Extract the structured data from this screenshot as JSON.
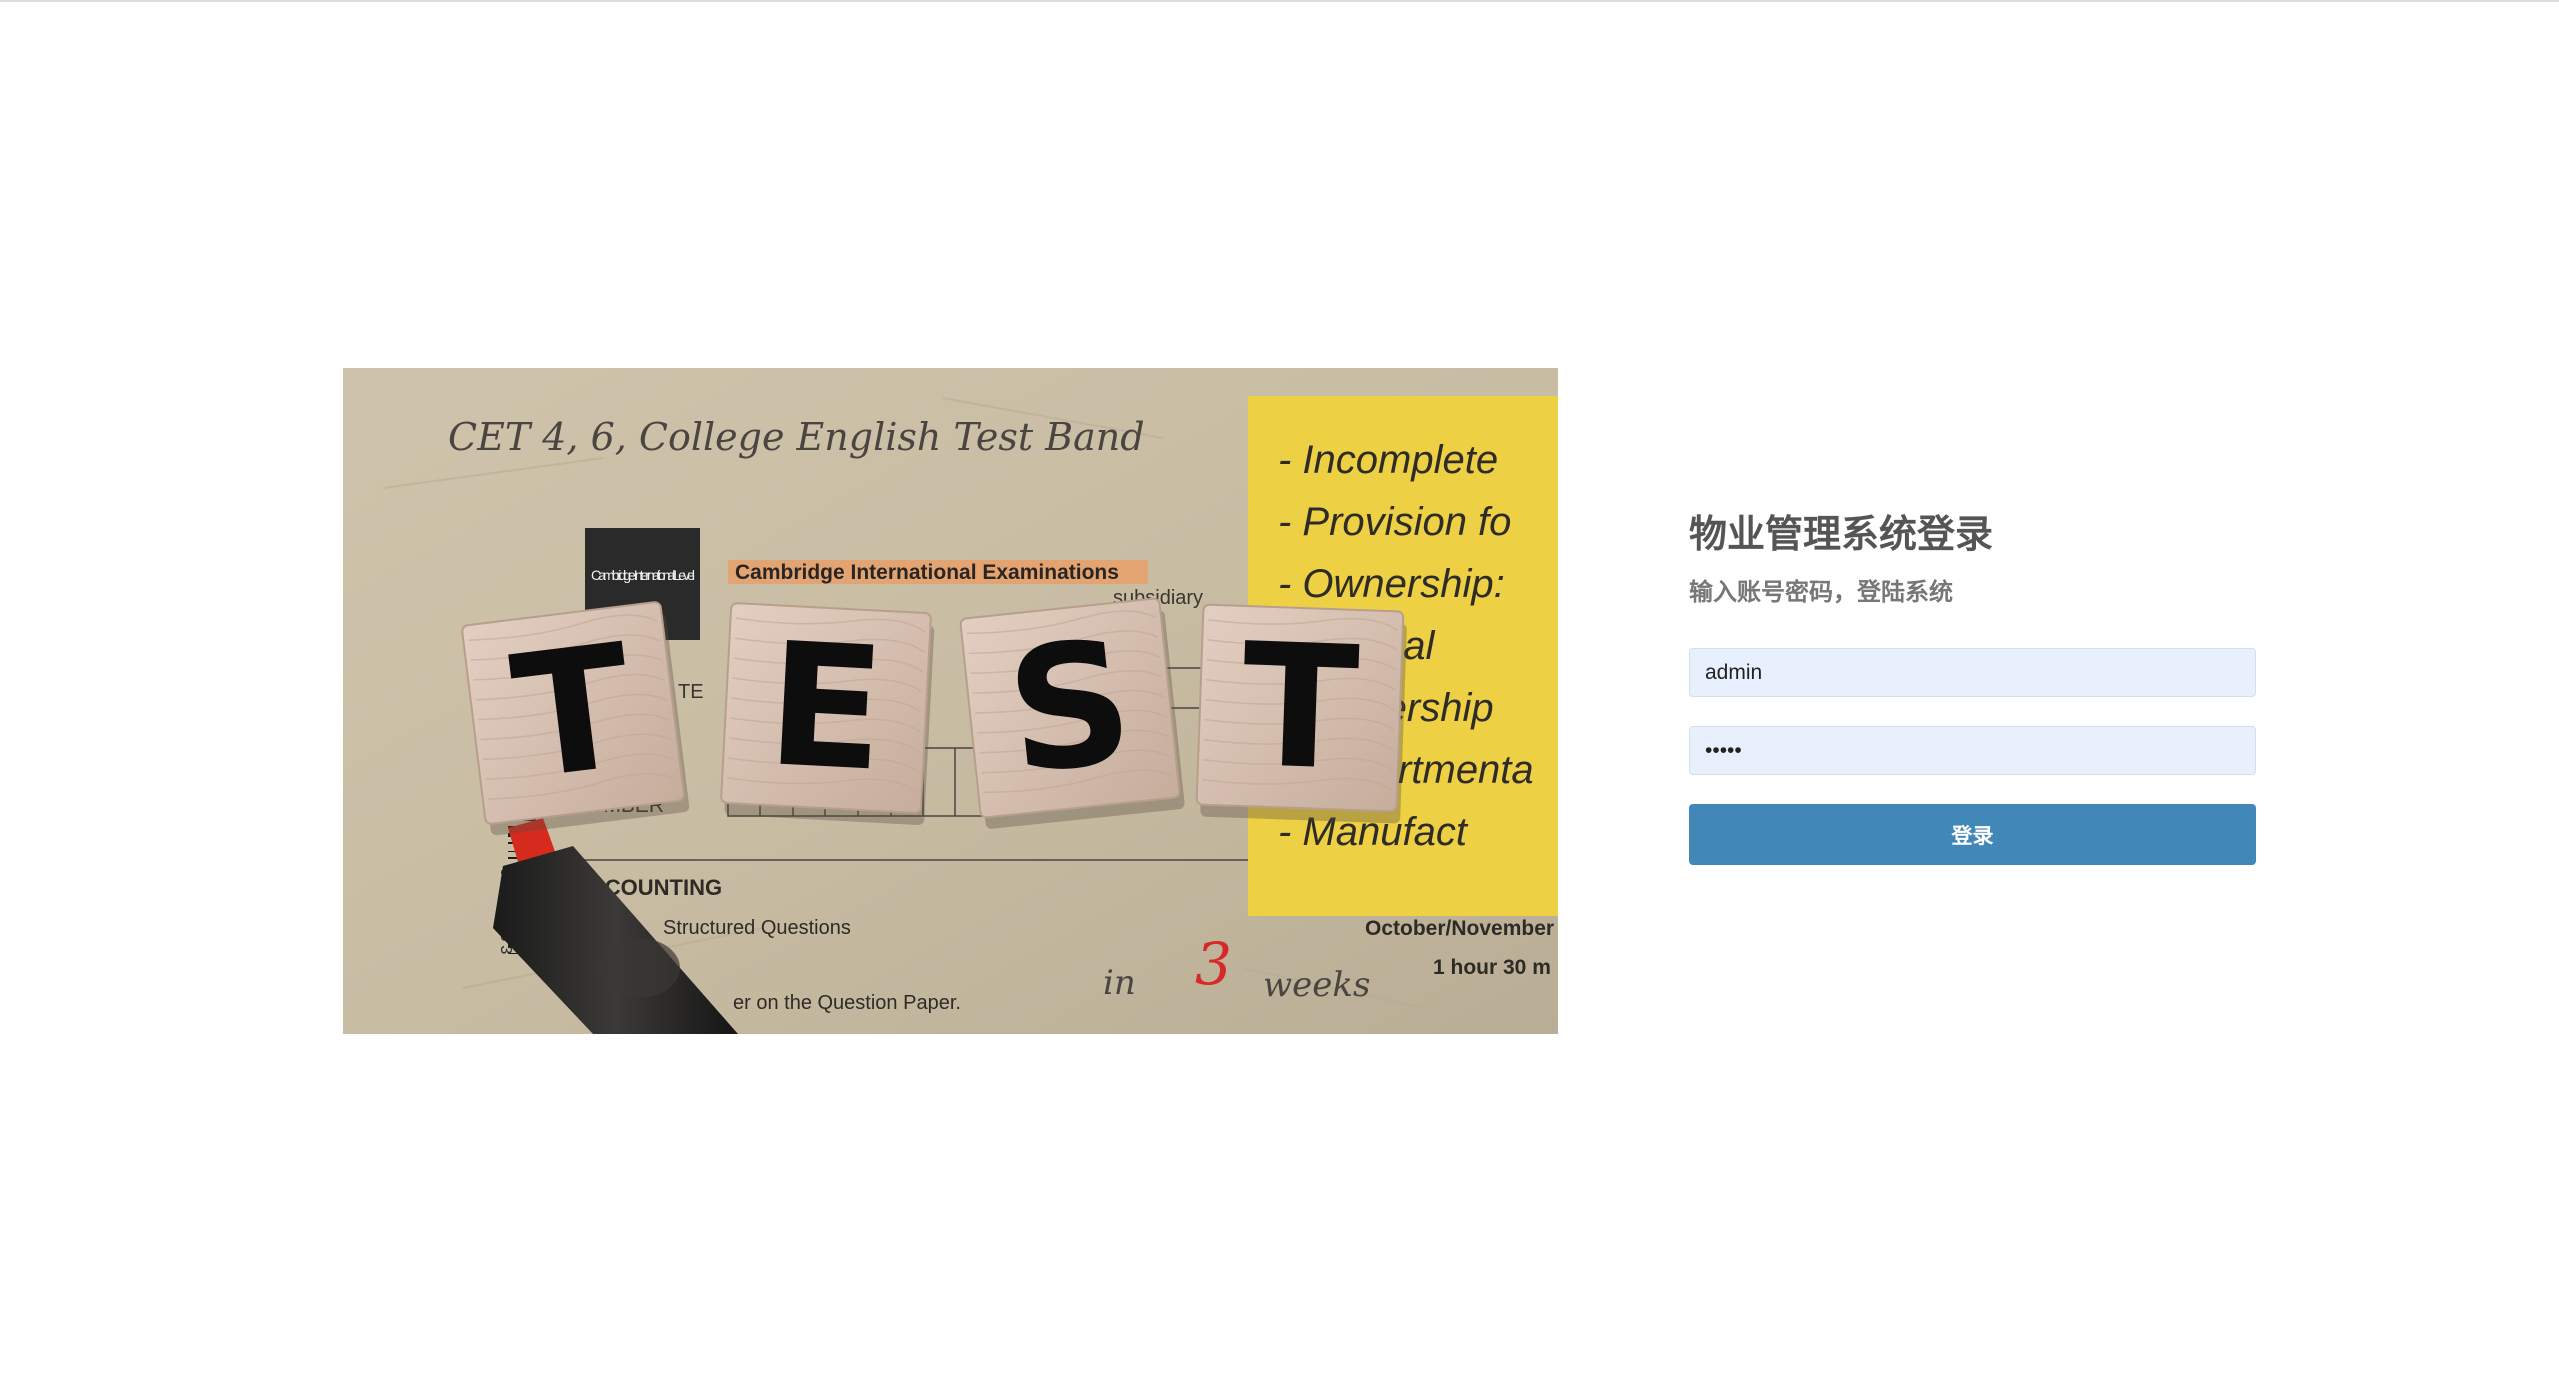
{
  "login": {
    "title": "物业管理系统登录",
    "subtitle": "输入账号密码，登陆系统",
    "username_value": "admin",
    "password_value": "admin",
    "submit_label": "登录"
  },
  "hero": {
    "tile_letters": [
      "T",
      "E",
      "S",
      "T"
    ],
    "handwritten_header": "CET 4, 6, College English Test Band",
    "sticky_note_lines": [
      "- Incomplete",
      "- Provision fo",
      "- Ownership:",
      "- Accrual",
      "- Ownership",
      "- Departmenta",
      "- Manufact"
    ],
    "exam_board": "Cambridge International Examinations",
    "exam_board_partial": "Cambridge International Level",
    "subsidiary": "subsidiary",
    "te_fragment": "TE",
    "number_label": "NUMBER",
    "subject": "ACCOUNTING",
    "paper": "Structured Questions",
    "instruction": "er on the Question Paper.",
    "session": "October/November",
    "duration": "1 hour 30 m",
    "scribble_in": "in",
    "scribble_num": "3",
    "scribble_weeks": "weeks",
    "barcode_digits": "6275563"
  },
  "colors": {
    "button": "#4187b7",
    "input_bg": "#e8f0fe",
    "title": "#555555",
    "subtitle": "#777777"
  }
}
